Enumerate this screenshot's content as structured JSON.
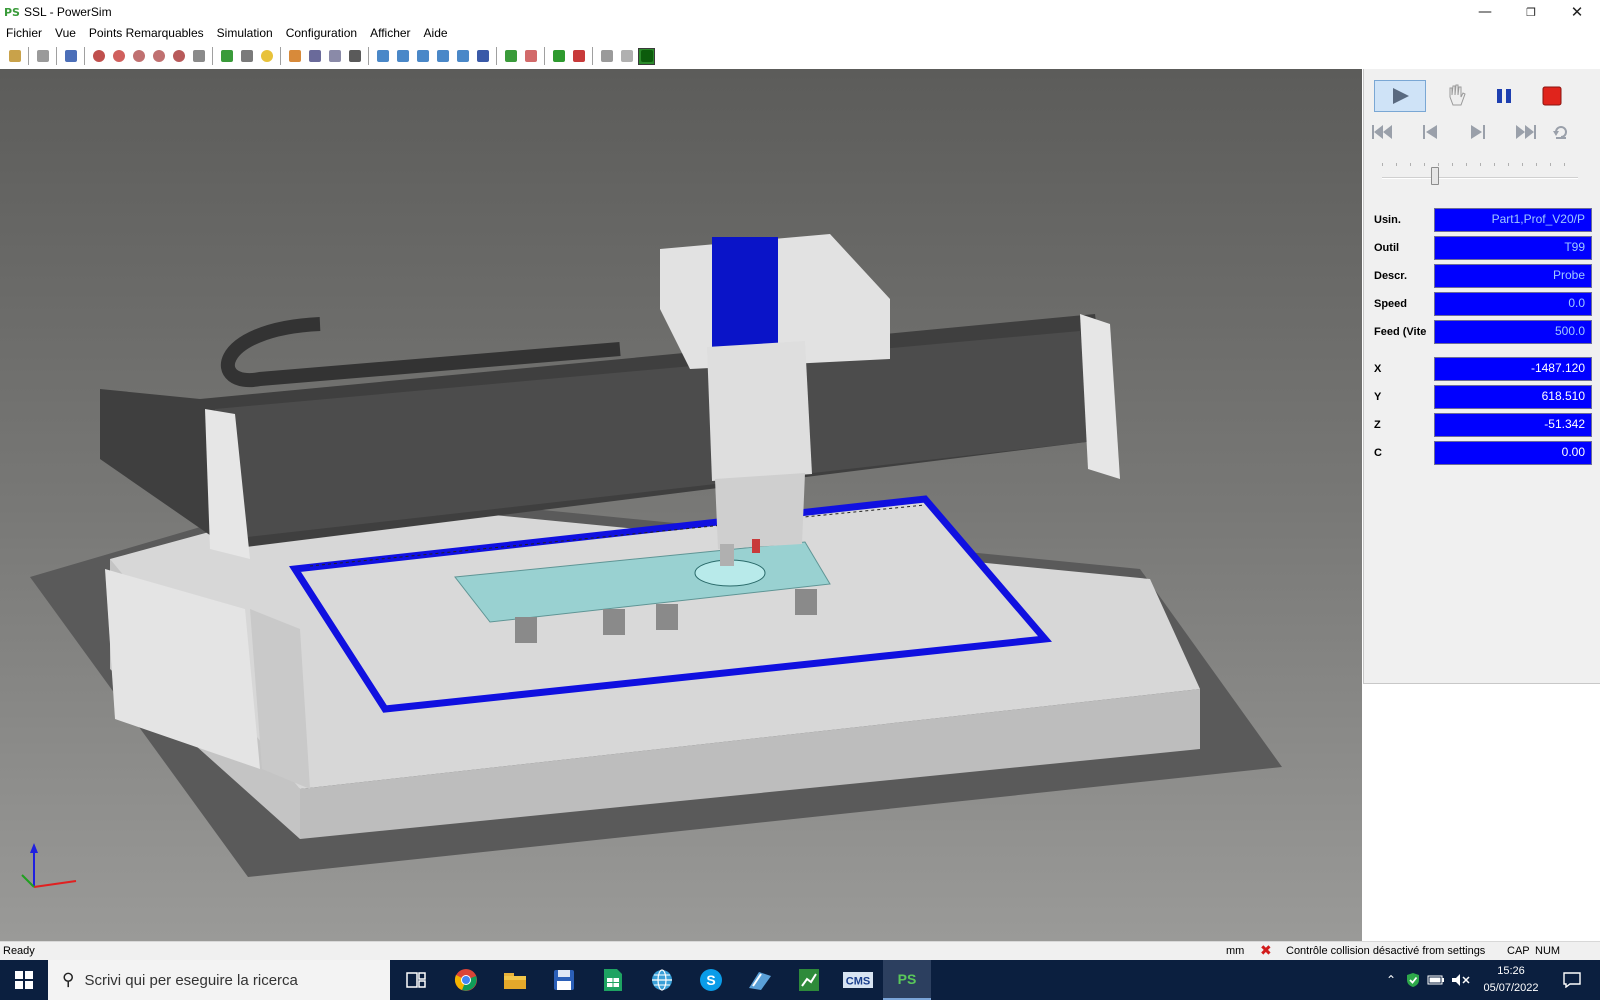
{
  "window": {
    "title": "SSL - PowerSim",
    "app_icon_text": "PS"
  },
  "menu": [
    "Fichier",
    "Vue",
    "Points Remarquables",
    "Simulation",
    "Configuration",
    "Afficher",
    "Aide"
  ],
  "panel": {
    "fields": [
      {
        "label": "Usin.",
        "value": "Part1,Prof_V20/P"
      },
      {
        "label": "Outil",
        "value": "T99"
      },
      {
        "label": "Descr.",
        "value": "Probe"
      },
      {
        "label": "Speed",
        "value": "0.0"
      },
      {
        "label": "Feed (Vite",
        "value": "500.0"
      }
    ],
    "coords": [
      {
        "label": "X",
        "value": "-1487.120"
      },
      {
        "label": "Y",
        "value": "618.510"
      },
      {
        "label": "Z",
        "value": "-51.342"
      },
      {
        "label": "C",
        "value": "0.00"
      }
    ],
    "slider_position": 0.27
  },
  "status": {
    "ready": "Ready",
    "unit": "mm",
    "collision": "Contrôle collision désactivé from settings",
    "cap": "CAP",
    "num": "NUM"
  },
  "taskbar": {
    "search_placeholder": "Scrivi qui per eseguire la ricerca",
    "cms_label": "CMS",
    "ps_label": "PS",
    "time": "15:26",
    "date": "05/07/2022"
  },
  "colors": {
    "field_bg": "#0000ff",
    "accent_blue": "#0a14c8",
    "taskbar_bg": "#0b1f3f",
    "stop_red": "#e0241c"
  }
}
